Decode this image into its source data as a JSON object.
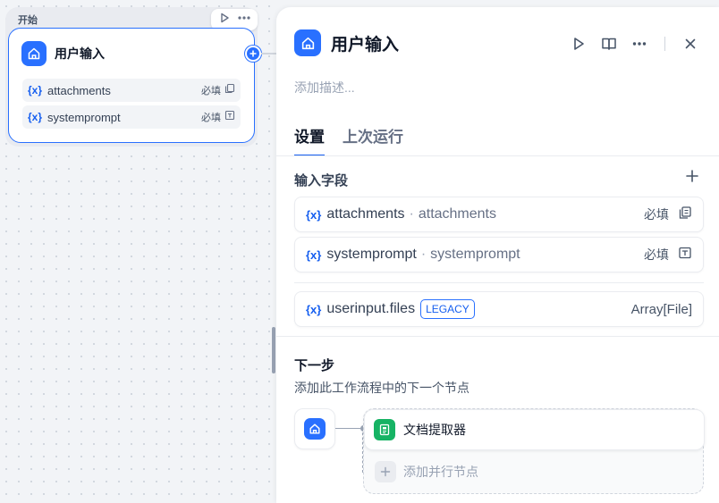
{
  "canvas": {
    "group_label": "开始",
    "node": {
      "title": "用户输入",
      "icon": "home-icon",
      "variables": [
        {
          "name": "attachments",
          "required": "必填",
          "icon": "file-list-icon"
        },
        {
          "name": "systemprompt",
          "required": "必填",
          "icon": "text-input-icon"
        }
      ]
    },
    "toolbar_icons": [
      "play-icon",
      "more-icon"
    ]
  },
  "panel": {
    "title": "用户输入",
    "description_placeholder": "添加描述...",
    "actions": [
      "play-icon",
      "book-icon",
      "more-icon",
      "close-icon"
    ],
    "tabs": [
      {
        "label": "设置",
        "active": true
      },
      {
        "label": "上次运行",
        "active": false
      }
    ],
    "fields_section": {
      "title": "输入字段",
      "fields": [
        {
          "var_symbol": "{x}",
          "name": "attachments",
          "separator": "·",
          "alias": "attachments",
          "required": "必填",
          "icon": "file-list-icon"
        },
        {
          "var_symbol": "{x}",
          "name": "systemprompt",
          "separator": "·",
          "alias": "systemprompt",
          "required": "必填",
          "icon": "text-input-icon"
        }
      ],
      "system_field": {
        "var_symbol": "{x}",
        "name": "userinput.files",
        "tag": "LEGACY",
        "type": "Array[File]"
      }
    },
    "next_step": {
      "title": "下一步",
      "subtitle": "添加此工作流程中的下一个节点",
      "nodes": [
        {
          "name": "文档提取器",
          "icon": "document-extractor-icon"
        }
      ],
      "add_parallel": "添加并行节点"
    }
  },
  "colors": {
    "accent": "#2970ff",
    "doc_extractor": "#16b364"
  }
}
